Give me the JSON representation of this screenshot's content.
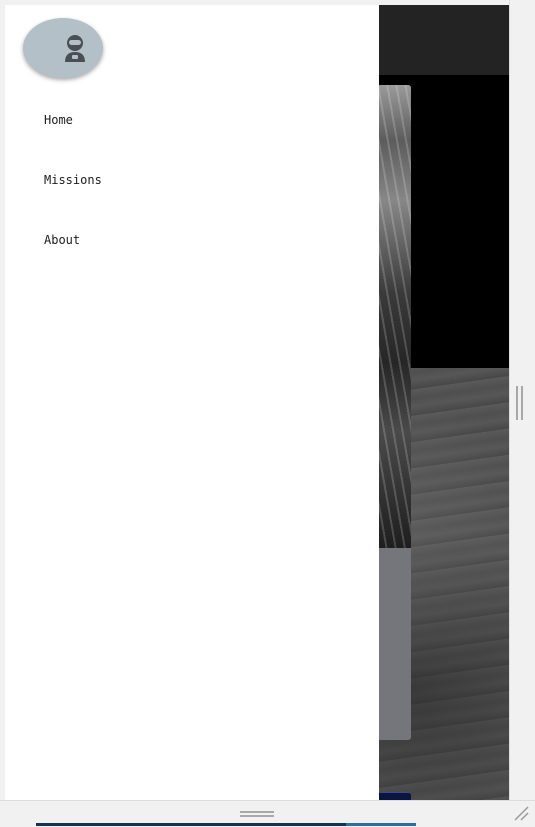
{
  "drawer": {
    "avatar_icon": "astronaut-icon",
    "items": [
      {
        "label": "Home"
      },
      {
        "label": "Missions"
      },
      {
        "label": "About"
      }
    ]
  },
  "colors": {
    "drawer_background": "#ffffff",
    "avatar_background": "#b4c0c7",
    "app_bar": "#232323",
    "nav_text": "#1e1e1e"
  }
}
